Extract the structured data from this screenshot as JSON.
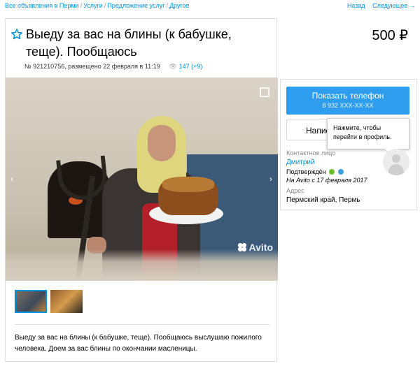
{
  "breadcrumbs": {
    "items": [
      "Все объявления в Перми",
      "Услуги",
      "Предложение услуг",
      "Другое"
    ],
    "separator": "/"
  },
  "nav": {
    "back": "Назад",
    "next": "Следующее →"
  },
  "listing": {
    "title": "Выеду за вас на блины (к бабушке, теще). Пообщаюсь",
    "price": "500 ₽",
    "meta": "№ 921210756, размещено 22 февраля в 11:19",
    "views": "147 (+9)",
    "description": "Выеду за вас на блины (к бабушке, теще). Пообщаюсь выслушаю пожилого человека. Доем за вас блины по окончании масленицы."
  },
  "gallery": {
    "watermark": "Avito",
    "prev": "‹",
    "next": "›",
    "thumbnails_count": 2
  },
  "contact": {
    "phone_button": "Показать телефон",
    "phone_masked": "8 932 ХХХ-ХХ-ХХ",
    "write_button": "Написать",
    "tooltip": "Нажмите, чтобы перейти в профиль.",
    "contact_label": "Контактное лицо",
    "seller_name": "Дмитрий",
    "verified": "Подтверждён",
    "since": "На Avito с 17 февраля 2017",
    "address_label": "Адрес",
    "address": "Пермский край, Пермь"
  },
  "colors": {
    "accent": "#0091d9",
    "button": "#2f9ded"
  },
  "icons": [
    "favorite-star-icon",
    "eye-icon",
    "expand-icon",
    "phone-verified-icon",
    "email-verified-icon",
    "avatar-placeholder-icon"
  ]
}
